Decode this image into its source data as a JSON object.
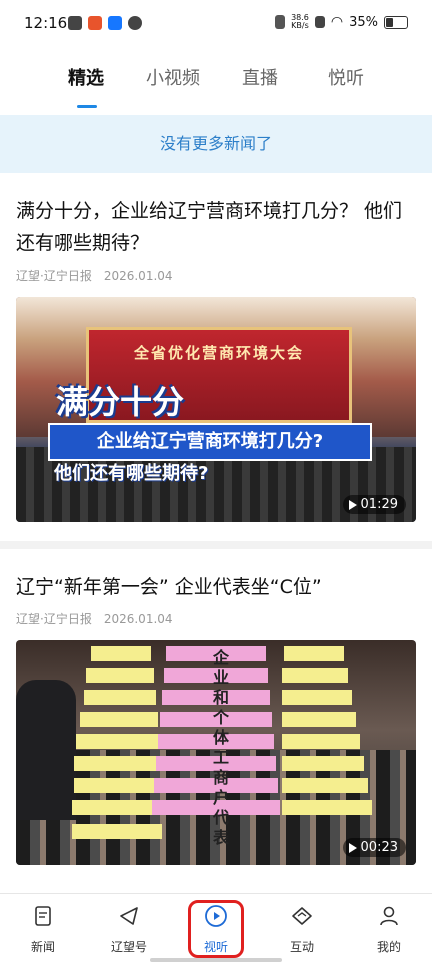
{
  "status": {
    "time": "12:16",
    "net_rate": "38.6",
    "net_unit": "KB/s",
    "battery": "35%"
  },
  "tabs": [
    {
      "label": "精选",
      "active": true
    },
    {
      "label": "小视频",
      "active": false
    },
    {
      "label": "直播",
      "active": false
    },
    {
      "label": "悦听",
      "active": false
    }
  ],
  "notice": "没有更多新闻了",
  "articles": [
    {
      "title": "满分十分，企业给辽宁营商环境打几分？ 他们还有哪些期待？",
      "source": "辽望·辽宁日报",
      "date": "2026.01.04",
      "duration": "01:29",
      "overlay": {
        "stage_text": "全省优化营商环境大会",
        "big": "满分十分",
        "line1": "企业给辽宁营商环境打几分?",
        "line2": "他们还有哪些期待?"
      }
    },
    {
      "title": "辽宁“新年第一会” 企业代表坐“C位”",
      "source": "辽望·辽宁日报",
      "date": "2026.01.04",
      "duration": "00:23",
      "overlay": {
        "vertical": "企业和个体工商户代表"
      }
    }
  ],
  "nav": [
    {
      "label": "新闻",
      "icon": "news-icon"
    },
    {
      "label": "辽望号",
      "icon": "send-icon"
    },
    {
      "label": "视听",
      "icon": "play-circle-icon",
      "active": true
    },
    {
      "label": "互动",
      "icon": "interact-icon"
    },
    {
      "label": "我的",
      "icon": "person-icon"
    }
  ],
  "colors": {
    "accent": "#1e88e5",
    "notice_bg": "#e6f3fb",
    "notice_text": "#2d7fc9",
    "highlight": "#e0201f"
  }
}
